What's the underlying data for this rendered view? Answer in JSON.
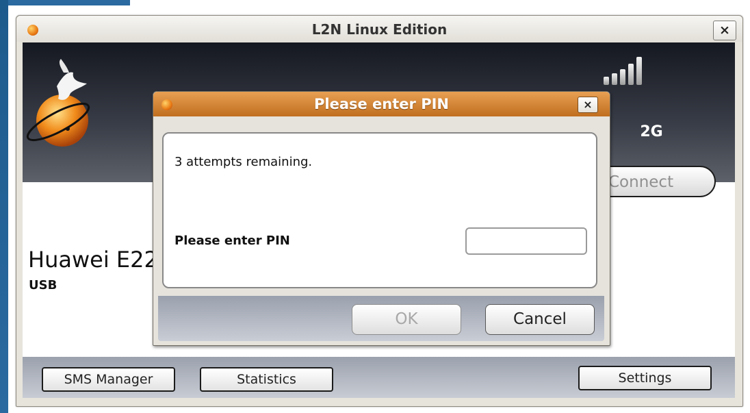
{
  "window": {
    "title": "L2N Linux Edition",
    "close_label": "×"
  },
  "status": {
    "network_type": "2G",
    "connect_label": "Connect",
    "signal_level": 5,
    "signal_max": 5
  },
  "device": {
    "name": "Huawei E22",
    "connection": "USB"
  },
  "footer": {
    "sms_label": "SMS Manager",
    "stats_label": "Statistics",
    "settings_label": "Settings"
  },
  "pin_dialog": {
    "title": "Please enter PIN",
    "close_label": "×",
    "attempts_text": "3 attempts remaining.",
    "pin_label": "Please enter PIN",
    "pin_value": "",
    "ok_label": "OK",
    "cancel_label": "Cancel"
  },
  "colors": {
    "dialog_titlebar": "#d2832f",
    "header_band": "#2b2f38",
    "footer_bar": "#b0b5bf",
    "desktop": "#1d5a8c"
  },
  "icons": [
    "app-icon",
    "dove-globe-logo",
    "signal-strength-icon",
    "close-icon"
  ]
}
